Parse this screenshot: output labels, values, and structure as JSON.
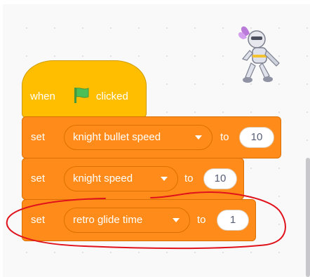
{
  "event_block": {
    "when_label": "when",
    "clicked_label": "clicked",
    "icon": "green-flag-icon"
  },
  "set_blocks": [
    {
      "keyword": "set",
      "variable": "knight bullet speed",
      "to_label": "to",
      "value": "10"
    },
    {
      "keyword": "set",
      "variable": "knight speed",
      "to_label": "to",
      "value": "10"
    },
    {
      "keyword": "set",
      "variable": "retro glide time",
      "to_label": "to",
      "value": "1"
    }
  ],
  "sprite": {
    "icon": "knight-sprite-icon"
  },
  "annotation": {
    "icon": "red-circle-highlight",
    "color": "#e0121c"
  },
  "colors": {
    "event_block": "#ffbf00",
    "variable_block": "#ff8c1a",
    "flag": "#4cbf56"
  }
}
